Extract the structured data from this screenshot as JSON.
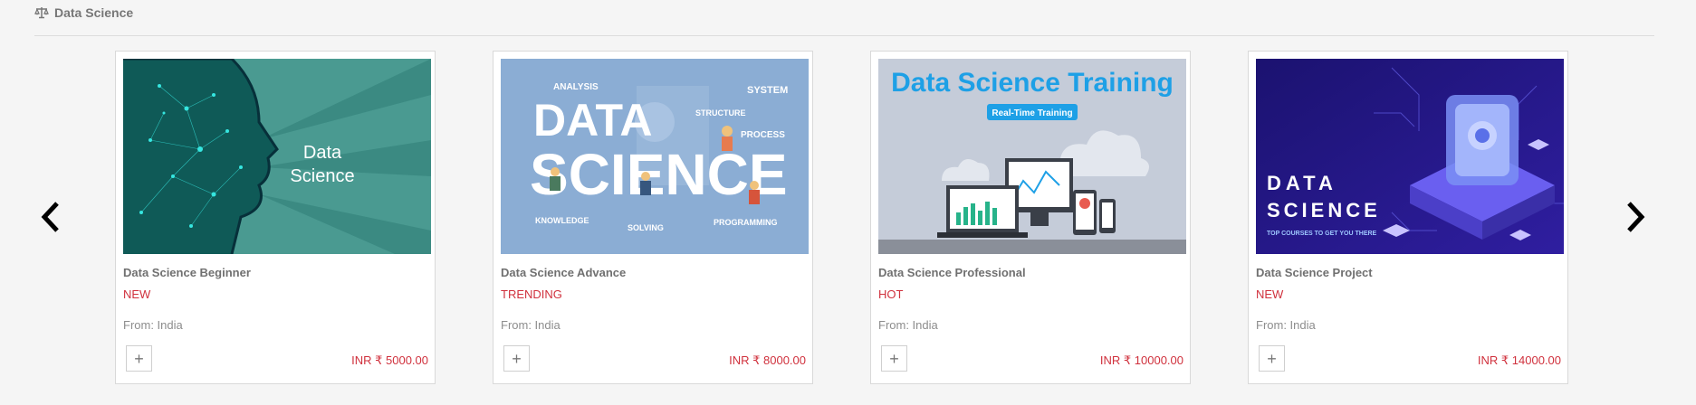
{
  "section": {
    "title": "Data Science",
    "icon": "scale-icon"
  },
  "carousel": {
    "prev_icon": "chevron-left-icon",
    "next_icon": "chevron-right-icon"
  },
  "cards": [
    {
      "name": "Data Science Beginner",
      "tag": "NEW",
      "origin": "From: India",
      "price": "INR ₹ 5000.00",
      "add_label": "+",
      "image_text": [
        "Data",
        "Science"
      ]
    },
    {
      "name": "Data Science Advance",
      "tag": "TRENDING",
      "origin": "From: India",
      "price": "INR ₹ 8000.00",
      "add_label": "+",
      "image_text": [
        "DATA",
        "SCIENCE",
        "ANALYSIS",
        "SYSTEM",
        "STRUCTURE",
        "PROCESS",
        "KNOWLEDGE",
        "SOLVING",
        "PROGRAMMING"
      ]
    },
    {
      "name": "Data Science Professional",
      "tag": "HOT",
      "origin": "From: India",
      "price": "INR ₹ 10000.00",
      "add_label": "+",
      "image_text": [
        "Data Science Training",
        "Real-Time Training"
      ]
    },
    {
      "name": "Data Science Project",
      "tag": "NEW",
      "origin": "From: India",
      "price": "INR ₹ 14000.00",
      "add_label": "+",
      "image_text": [
        "DATA",
        "SCIENCE",
        "TOP COURSES TO GET YOU THERE"
      ]
    }
  ],
  "colors": {
    "tag": "#d0313d",
    "price": "#d0313d",
    "name": "#707070"
  }
}
